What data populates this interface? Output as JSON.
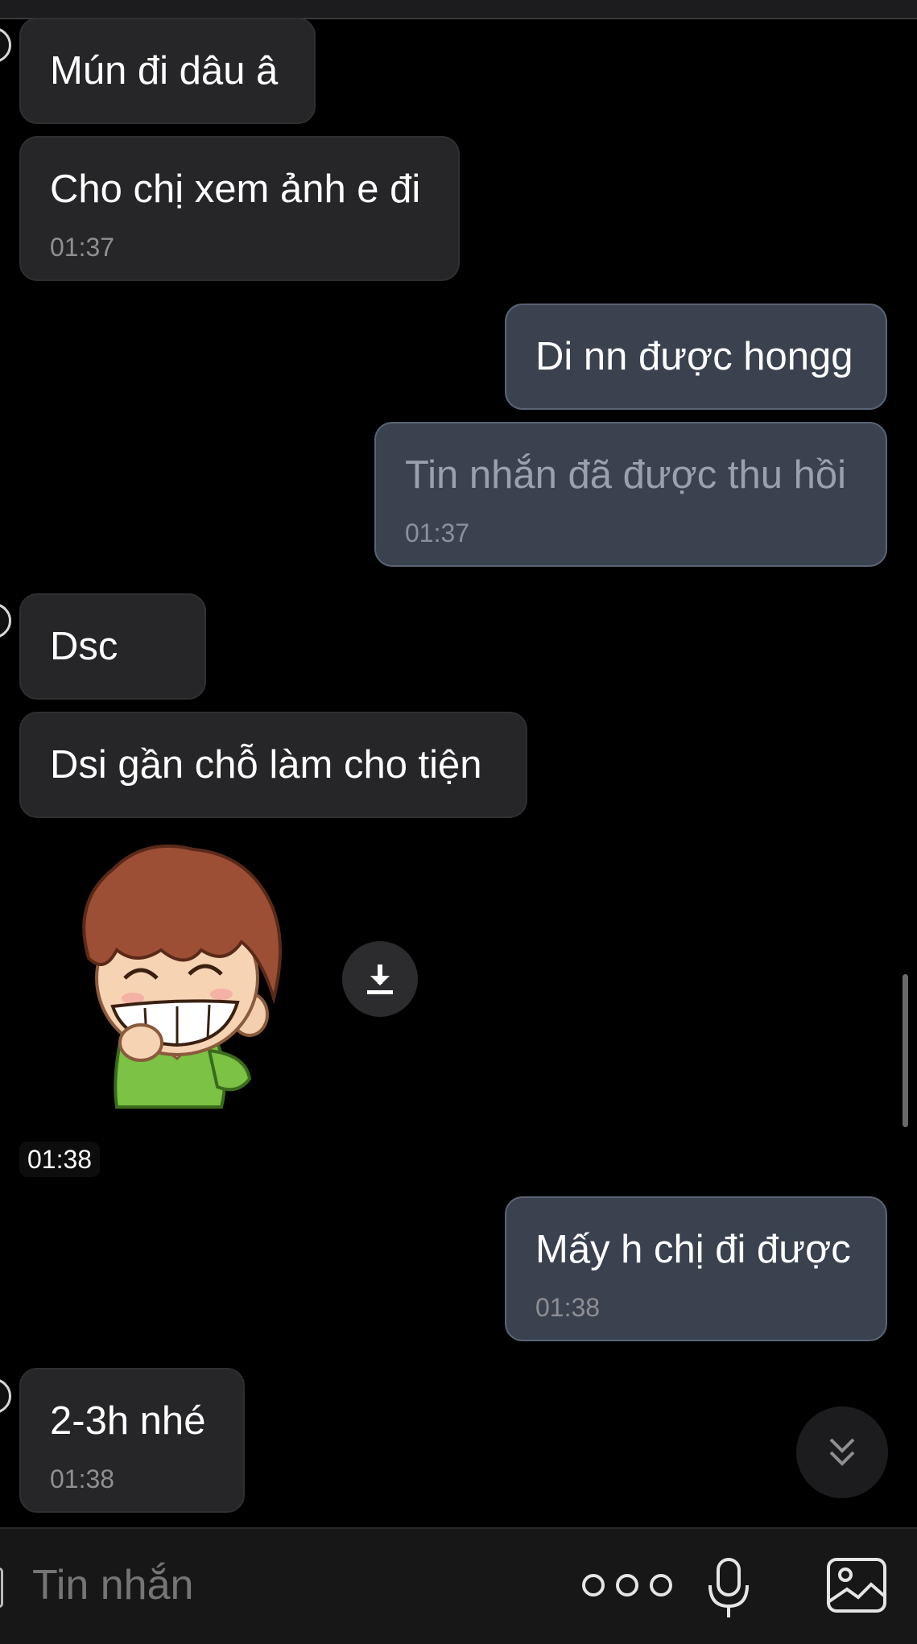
{
  "messages": [
    {
      "side": "in",
      "text": "Mún đi dâu â",
      "time": ""
    },
    {
      "side": "in",
      "text": "Cho chị xem ảnh e đi",
      "time": "01:37"
    },
    {
      "side": "out",
      "text": "Di nn được hongg",
      "time": ""
    },
    {
      "side": "out",
      "text": "Tin nhắn đã được thu hồi",
      "time": "01:37",
      "recalled": true
    },
    {
      "side": "in",
      "text": "Dsc",
      "time": ""
    },
    {
      "side": "in",
      "text": "Dsi gần chỗ làm cho tiện",
      "time": ""
    },
    {
      "side": "out",
      "text": "Mấy h chị đi được",
      "time": "01:38"
    },
    {
      "side": "in",
      "text": "2-3h nhé",
      "time": "01:38"
    }
  ],
  "sticker": {
    "time": "01:38",
    "download_icon": "download-icon"
  },
  "composer": {
    "placeholder": "Tin nhắn",
    "icons": [
      "more-dots-icon",
      "microphone-icon",
      "image-icon"
    ]
  },
  "scroll_down_icon": "chevron-double-down-icon",
  "colors": {
    "incoming_bubble": "#262628",
    "outgoing_bubble": "#3a4250",
    "background": "#000000"
  }
}
